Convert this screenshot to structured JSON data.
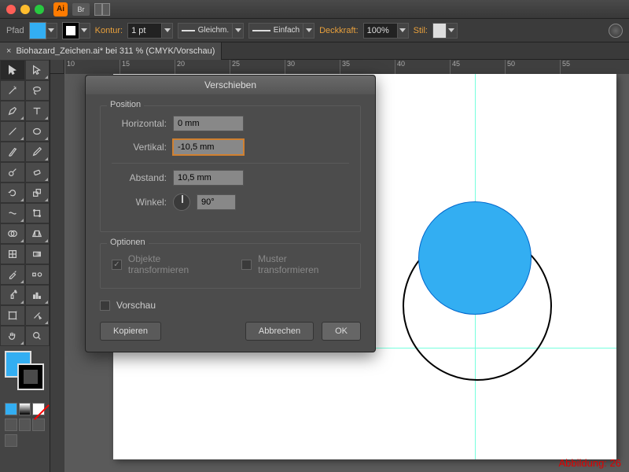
{
  "titlebar": {
    "br": "Br"
  },
  "optbar": {
    "path_label": "Pfad",
    "kontur_label": "Kontur:",
    "stroke_weight": "1 pt",
    "cap_label": "Gleichm.",
    "dash_label": "Einfach",
    "opacity_label": "Deckkraft:",
    "opacity_value": "100%",
    "style_label": "Stil:"
  },
  "doc": {
    "tab": "Biohazard_Zeichen.ai* bei 311 % (CMYK/Vorschau)"
  },
  "ruler": {
    "marks": [
      "10",
      "15",
      "20",
      "25",
      "30",
      "35",
      "40",
      "45",
      "50",
      "55"
    ]
  },
  "dialog": {
    "title": "Verschieben",
    "position_group": "Position",
    "horizontal_label": "Horizontal:",
    "horizontal_value": "0 mm",
    "vertical_label": "Vertikal:",
    "vertical_value": "-10,5 mm",
    "abstand_label": "Abstand:",
    "abstand_value": "10,5 mm",
    "winkel_label": "Winkel:",
    "winkel_value": "90°",
    "options_group": "Optionen",
    "transform_objects": "Objekte transformieren",
    "transform_patterns": "Muster transformieren",
    "preview": "Vorschau",
    "copy_btn": "Kopieren",
    "cancel_btn": "Abbrechen",
    "ok_btn": "OK"
  },
  "caption": "Abbildung: 26"
}
